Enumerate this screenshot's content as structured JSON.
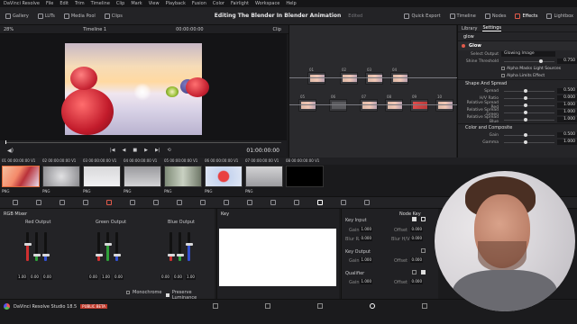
{
  "menu": {
    "items": [
      "DaVinci Resolve",
      "File",
      "Edit",
      "Trim",
      "Timeline",
      "Clip",
      "Mark",
      "View",
      "Playback",
      "Fusion",
      "Color",
      "Fairlight",
      "Workspace",
      "Help"
    ]
  },
  "toolbar": {
    "left": [
      "Gallery",
      "LUTs",
      "Media Pool",
      "Clips"
    ],
    "project_title": "Editing The Blender In Blender Animation",
    "edited_label": "Edited",
    "right": [
      "Quick Export",
      "Timeline",
      "Nodes",
      "Effects",
      "Lightbox"
    ]
  },
  "viewer": {
    "zoom": "28%",
    "timeline_name": "Timeline 1",
    "timecode_top": "00:00:00:00",
    "clip_label": "Clip",
    "timecode_bottom": "01:00:00:00"
  },
  "settings": {
    "tabs": [
      "Library",
      "Settings"
    ],
    "search_value": "glow",
    "effect_title": "Glow",
    "select_output_label": "Select Output",
    "select_output_value": "Glowing Image",
    "shine_threshold_label": "Shine Threshold",
    "shine_threshold_value": "0.750",
    "checkbox_alpha_masks": "Alpha Masks Light Sources",
    "checkbox_alpha_limits": "Alpha Limits Effect",
    "section_spread": "Shape And Spread",
    "params_spread": [
      {
        "name": "Spread",
        "value": "0.500"
      },
      {
        "name": "H/V Ratio",
        "value": "0.000"
      },
      {
        "name": "Relative Spread Red",
        "value": "1.000"
      },
      {
        "name": "Relative Spread Green",
        "value": "1.000"
      },
      {
        "name": "Relative Spread Blue",
        "value": "1.000"
      }
    ],
    "section_color": "Color and Composite",
    "params_color": [
      {
        "name": "Gain",
        "value": "0.500"
      },
      {
        "name": "Gamma",
        "value": "1.000"
      }
    ]
  },
  "clips": {
    "items": [
      {
        "num": "01",
        "time": "00:00:00:00",
        "track": "V1",
        "format": "PNG"
      },
      {
        "num": "02",
        "time": "00:00:00:00",
        "track": "V1",
        "format": "PNG"
      },
      {
        "num": "03",
        "time": "00:00:00:00",
        "track": "V1",
        "format": "PNG"
      },
      {
        "num": "04",
        "time": "00:00:00:00",
        "track": "V1",
        "format": "PNG"
      },
      {
        "num": "05",
        "time": "00:00:00:00",
        "track": "V1",
        "format": "PNG"
      },
      {
        "num": "06",
        "time": "00:00:00:00",
        "track": "V1",
        "format": "PNG"
      },
      {
        "num": "07",
        "time": "00:00:00:00",
        "track": "V1",
        "format": "PNG"
      },
      {
        "num": "08",
        "time": "00:00:00:00",
        "track": "V1",
        "format": ""
      }
    ]
  },
  "mixer": {
    "title": "RGB Mixer",
    "red_output": "Red Output",
    "green_output": "Green Output",
    "blue_output": "Blue Output",
    "red_values": [
      "1.00",
      "0.00",
      "0.00"
    ],
    "green_values": [
      "0.00",
      "1.00",
      "0.00"
    ],
    "blue_values": [
      "0.00",
      "0.00",
      "1.00"
    ],
    "monochrome_label": "Monochrome",
    "preserve_label": "Preserve Luminance"
  },
  "key": {
    "title": "Key",
    "node_key_title": "Node Key",
    "key_input_label": "Key Input",
    "gain_label": "Gain",
    "offset_label": "Offset",
    "blur_r_label": "Blur R.",
    "blur_h_label": "Blur H/V",
    "key_input_gain": "1.000",
    "key_input_offset": "0.000",
    "key_input_blur_r": "0.000",
    "key_input_blur_h": "0.000",
    "key_output_label": "Key Output",
    "key_output_gain": "1.000",
    "key_output_offset": "0.000",
    "qualifier_label": "Qualifier",
    "qualifier_gain": "1.000",
    "qualifier_offset": "0.000"
  },
  "status": {
    "app_version": "DaVinci Resolve Studio 18.5",
    "badge": "PUBLIC BETA"
  },
  "colors": {
    "accent_orange": "#e06a3b",
    "badge_red": "#c0392b",
    "active_tab": "#e05a4a"
  }
}
